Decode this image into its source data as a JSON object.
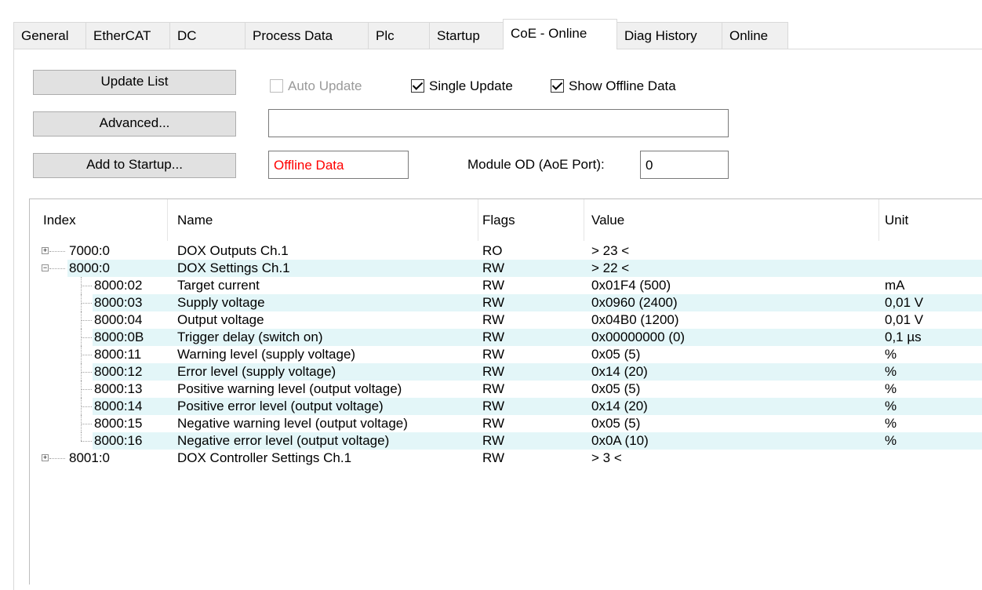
{
  "tabs": [
    "General",
    "EtherCAT",
    "DC",
    "Process Data",
    "Plc",
    "Startup",
    "CoE - Online",
    "Diag History",
    "Online"
  ],
  "active_tab": "CoE - Online",
  "buttons": {
    "update_list": "Update List",
    "advanced": "Advanced...",
    "add_to_startup": "Add to Startup..."
  },
  "checkboxes": {
    "auto_update": {
      "label": "Auto Update",
      "checked": false,
      "enabled": false
    },
    "single_update": {
      "label": "Single Update",
      "checked": true,
      "enabled": true
    },
    "show_offline": {
      "label": "Show Offline Data",
      "checked": true,
      "enabled": true
    }
  },
  "fields": {
    "description": "",
    "offline_data": "Offline Data",
    "module_od_label": "Module OD (AoE Port):",
    "module_od_value": "0"
  },
  "colors": {
    "offline_text": "#ff0000",
    "alt_row": "#e3f6f8"
  },
  "table": {
    "headers": [
      "Index",
      "Name",
      "Flags",
      "Value",
      "Unit"
    ],
    "rows": [
      {
        "index": "7000:0",
        "name": "DOX Outputs Ch.1",
        "flags": "RO",
        "value": "> 23 <",
        "unit": "",
        "type": "collapsed"
      },
      {
        "index": "8000:0",
        "name": "DOX Settings Ch.1",
        "flags": "RW",
        "value": "> 22 <",
        "unit": "",
        "type": "expanded"
      },
      {
        "index": "8000:02",
        "name": "Target current",
        "flags": "RW",
        "value": "0x01F4 (500)",
        "unit": "mA",
        "type": "child"
      },
      {
        "index": "8000:03",
        "name": "Supply voltage",
        "flags": "RW",
        "value": "0x0960 (2400)",
        "unit": "0,01 V",
        "type": "child"
      },
      {
        "index": "8000:04",
        "name": "Output voltage",
        "flags": "RW",
        "value": "0x04B0 (1200)",
        "unit": "0,01 V",
        "type": "child"
      },
      {
        "index": "8000:0B",
        "name": "Trigger delay (switch on)",
        "flags": "RW",
        "value": "0x00000000 (0)",
        "unit": "0,1 µs",
        "type": "child"
      },
      {
        "index": "8000:11",
        "name": "Warning level (supply voltage)",
        "flags": "RW",
        "value": "0x05 (5)",
        "unit": "%",
        "type": "child"
      },
      {
        "index": "8000:12",
        "name": "Error level (supply voltage)",
        "flags": "RW",
        "value": "0x14 (20)",
        "unit": "%",
        "type": "child"
      },
      {
        "index": "8000:13",
        "name": "Positive warning level (output voltage)",
        "flags": "RW",
        "value": "0x05 (5)",
        "unit": "%",
        "type": "child"
      },
      {
        "index": "8000:14",
        "name": "Positive error level (output voltage)",
        "flags": "RW",
        "value": "0x14 (20)",
        "unit": "%",
        "type": "child"
      },
      {
        "index": "8000:15",
        "name": "Negative warning level (output voltage)",
        "flags": "RW",
        "value": "0x05 (5)",
        "unit": "%",
        "type": "child"
      },
      {
        "index": "8000:16",
        "name": "Negative error level (output voltage)",
        "flags": "RW",
        "value": "0x0A (10)",
        "unit": "%",
        "type": "lastchild"
      },
      {
        "index": "8001:0",
        "name": "DOX Controller Settings Ch.1",
        "flags": "RW",
        "value": "> 3 <",
        "unit": "",
        "type": "collapsed"
      }
    ]
  }
}
